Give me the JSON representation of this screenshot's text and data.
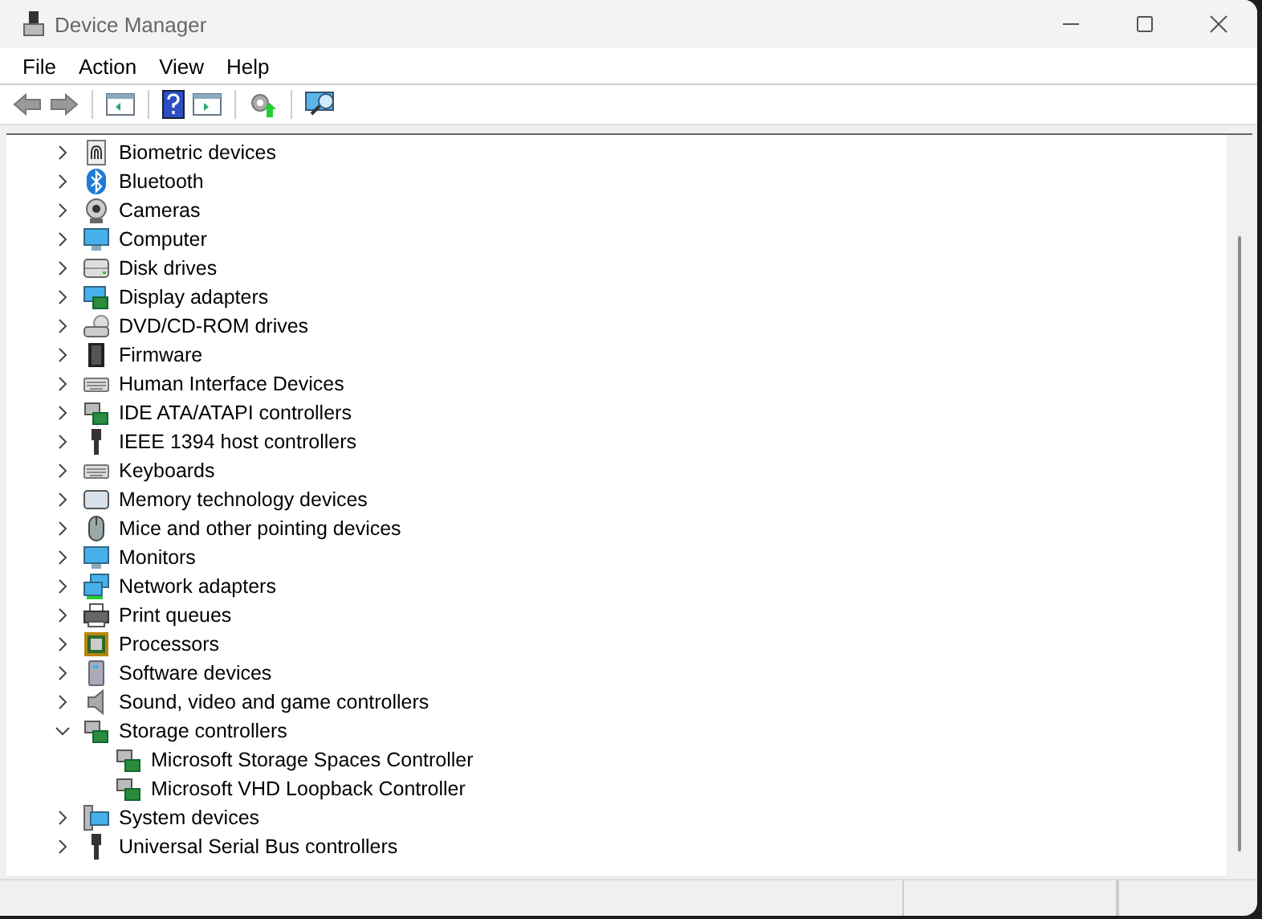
{
  "window": {
    "title": "Device Manager"
  },
  "menu": [
    "File",
    "Action",
    "View",
    "Help"
  ],
  "tree": [
    {
      "label": "Biometric devices",
      "expanded": false
    },
    {
      "label": "Bluetooth",
      "expanded": false
    },
    {
      "label": "Cameras",
      "expanded": false
    },
    {
      "label": "Computer",
      "expanded": false
    },
    {
      "label": "Disk drives",
      "expanded": false
    },
    {
      "label": "Display adapters",
      "expanded": false
    },
    {
      "label": "DVD/CD-ROM drives",
      "expanded": false
    },
    {
      "label": "Firmware",
      "expanded": false
    },
    {
      "label": "Human Interface Devices",
      "expanded": false
    },
    {
      "label": "IDE ATA/ATAPI controllers",
      "expanded": false
    },
    {
      "label": "IEEE 1394 host controllers",
      "expanded": false
    },
    {
      "label": "Keyboards",
      "expanded": false
    },
    {
      "label": "Memory technology devices",
      "expanded": false
    },
    {
      "label": "Mice and other pointing devices",
      "expanded": false
    },
    {
      "label": "Monitors",
      "expanded": false
    },
    {
      "label": "Network adapters",
      "expanded": false
    },
    {
      "label": "Print queues",
      "expanded": false
    },
    {
      "label": "Processors",
      "expanded": false
    },
    {
      "label": "Software devices",
      "expanded": false
    },
    {
      "label": "Sound, video and game controllers",
      "expanded": false
    },
    {
      "label": "Storage controllers",
      "expanded": true,
      "children": [
        {
          "label": "Microsoft Storage Spaces Controller"
        },
        {
          "label": "Microsoft VHD Loopback Controller"
        }
      ]
    },
    {
      "label": "System devices",
      "expanded": false
    },
    {
      "label": "Universal Serial Bus controllers",
      "expanded": false
    }
  ]
}
